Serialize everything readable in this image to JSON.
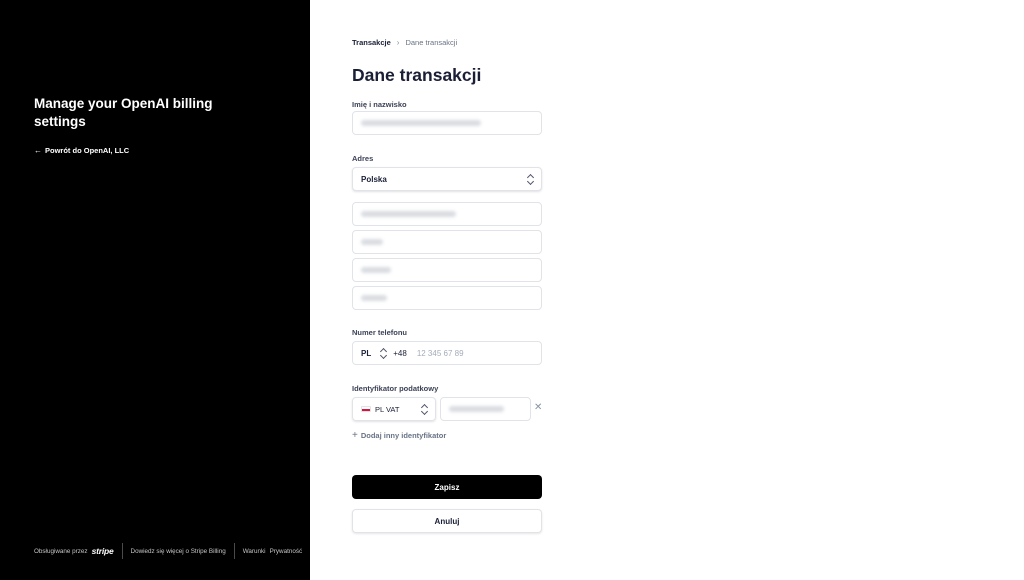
{
  "sidebar": {
    "title": "Manage your OpenAI billing settings",
    "back_link": "Powrót do OpenAI, LLC",
    "footer": {
      "powered_by": "Obsługiwane przez",
      "stripe_logo": "stripe",
      "learn_more": "Dowiedz się więcej o Stripe Billing",
      "terms": "Warunki",
      "privacy": "Prywatność"
    }
  },
  "breadcrumb": {
    "parent": "Transakcje",
    "current": "Dane transakcji"
  },
  "form": {
    "heading": "Dane transakcji",
    "name_label": "Imię i nazwisko",
    "address_label": "Adres",
    "country_value": "Polska",
    "phone_label": "Numer telefonu",
    "phone_country": "PL",
    "phone_dial_code": "+48",
    "phone_placeholder": "12 345 67 89",
    "tax_label": "Identyfikator podatkowy",
    "tax_type": "PL VAT",
    "add_tax_id": "Dodaj inny identyfikator",
    "save_button": "Zapisz",
    "cancel_button": "Anuluj"
  },
  "icons": {
    "back": "arrow-left-icon",
    "breadcrumb_separator": "chevron-right-icon",
    "select_arrows": "up-down-chevron-icon",
    "remove": "close-icon",
    "add": "plus-icon",
    "flag": "poland-flag-icon"
  },
  "colors": {
    "sidebar_bg": "#000000",
    "primary_button": "#000000",
    "border": "#e0e3e8",
    "text": "#1a1f36"
  }
}
